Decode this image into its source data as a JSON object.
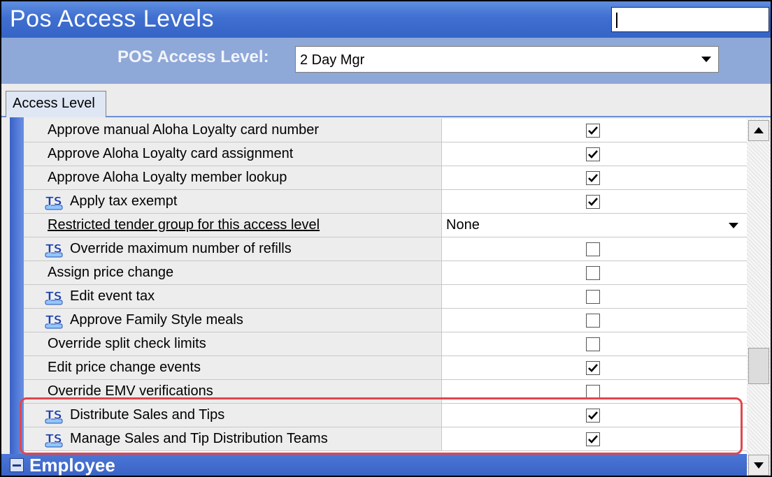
{
  "window": {
    "title": "Pos Access Levels",
    "search_value": ""
  },
  "selector": {
    "label": "POS Access Level:",
    "value": "2 Day Mgr"
  },
  "tabs": [
    {
      "label": "Access Level"
    }
  ],
  "grid": {
    "rows": [
      {
        "label": "Approve manual Aloha Loyalty card number",
        "ts": false,
        "checked": true
      },
      {
        "label": "Approve Aloha Loyalty card assignment",
        "ts": false,
        "checked": true
      },
      {
        "label": "Approve Aloha Loyalty member lookup",
        "ts": false,
        "checked": true
      },
      {
        "label": "Apply tax exempt",
        "ts": true,
        "checked": true
      },
      {
        "label": "Restricted tender group for this access level",
        "ts": false,
        "dropdown_value": "None"
      },
      {
        "label": "Override maximum number of refills",
        "ts": true,
        "checked": false
      },
      {
        "label": "Assign price change",
        "ts": false,
        "checked": false
      },
      {
        "label": "Edit event tax",
        "ts": true,
        "checked": false
      },
      {
        "label": "Approve Family Style meals",
        "ts": true,
        "checked": false
      },
      {
        "label": "Override split check limits",
        "ts": false,
        "checked": false
      },
      {
        "label": "Edit price change events",
        "ts": false,
        "checked": true
      },
      {
        "label": "Override EMV verifications",
        "ts": false,
        "checked": false
      },
      {
        "label": "Distribute Sales and Tips",
        "ts": true,
        "checked": true,
        "highlighted": true
      },
      {
        "label": "Manage Sales and Tip Distribution Teams",
        "ts": true,
        "checked": true,
        "highlighted": true
      }
    ],
    "section_title": "Employee"
  },
  "ts_icon_text": "TS",
  "colors": {
    "title_bar": "#3f6fd0",
    "selector_bar": "#8ea8d8",
    "section_bar": "#3a63c6",
    "highlight": "#e0464e"
  }
}
